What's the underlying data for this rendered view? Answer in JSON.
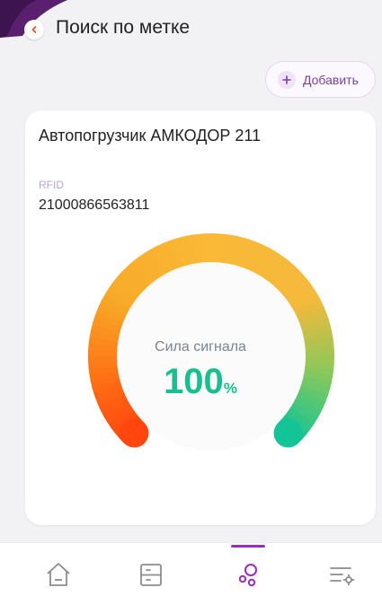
{
  "header": {
    "title": "Поиск по метке"
  },
  "toolbar": {
    "add_label": "Добавить"
  },
  "card": {
    "device_name": "Автопогрузчик АМКОДОР 211",
    "rfid_label": "RFID",
    "rfid_value": "21000866563811"
  },
  "signal": {
    "label": "Сила сигнала",
    "value": "100",
    "unit": "%",
    "level": 1.0
  },
  "colors": {
    "accent": "#9b2dbf",
    "signal_high": "#1bbf8f",
    "signal_mid": "#f7b731",
    "signal_low": "#ff4a12"
  },
  "nav": {
    "items": [
      {
        "icon": "home-icon",
        "active": false
      },
      {
        "icon": "list-icon",
        "active": false
      },
      {
        "icon": "tag-search-icon",
        "active": true
      },
      {
        "icon": "settings-icon",
        "active": false
      }
    ]
  }
}
